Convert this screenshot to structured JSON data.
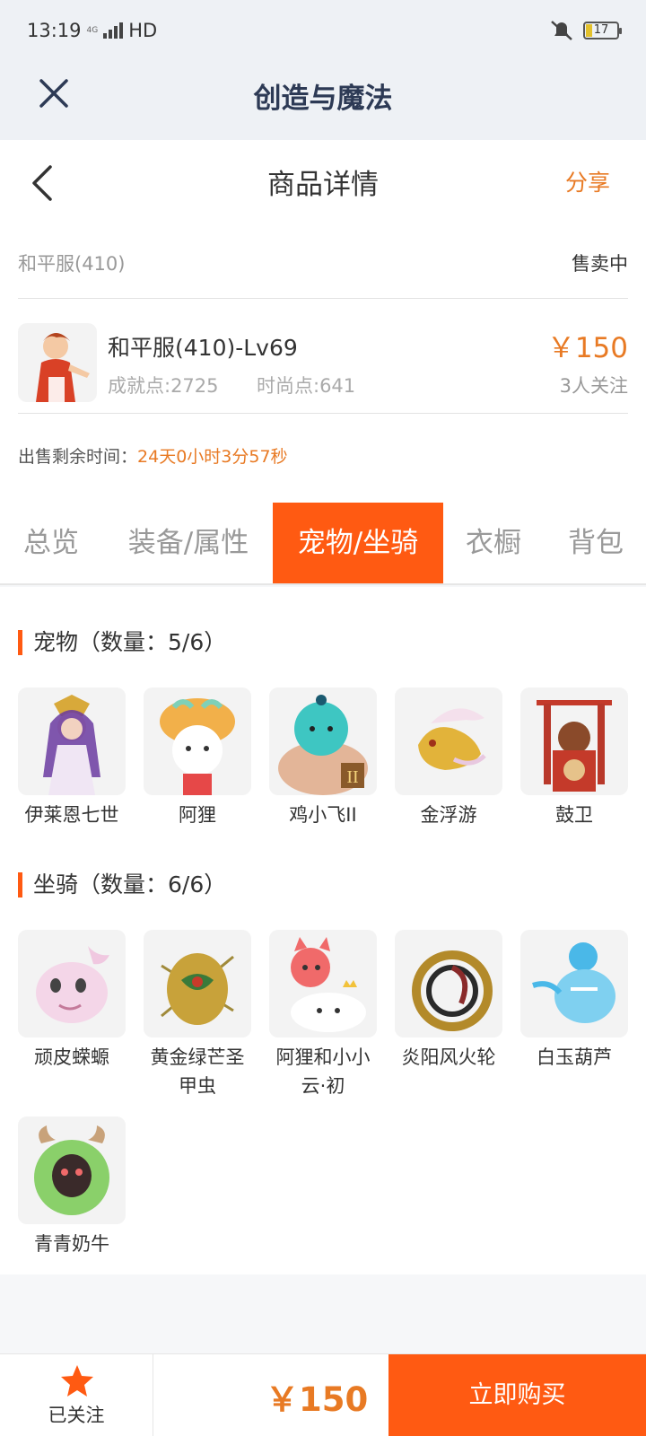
{
  "status_bar": {
    "time": "13:19",
    "network": "4G",
    "hd": "HD",
    "battery": "17"
  },
  "app": {
    "title": "创造与魔法"
  },
  "detail": {
    "title": "商品详情",
    "share": "分享",
    "server": "和平服(410)",
    "sale_status": "售卖中",
    "character": "和平服(410)-Lv69",
    "achievement": "成就点:2725",
    "fashion": "时尚点:641",
    "price": "￥150",
    "followers": "3人关注",
    "remaining_label": "出售剩余时间：",
    "remaining_time": "24天0小时3分57秒"
  },
  "tabs": [
    "总览",
    "装备/属性",
    "宠物/坐骑",
    "衣橱",
    "背包"
  ],
  "active_tab": "宠物/坐骑",
  "pets": {
    "title": "宠物（数量：5/6）",
    "items": [
      {
        "name": "伊莱恩七世",
        "color": "#a066c8"
      },
      {
        "name": "阿狸",
        "color": "#f2b04a"
      },
      {
        "name": "鸡小飞II",
        "color": "#3ec6c2"
      },
      {
        "name": "金浮游",
        "color": "#e2b33a"
      },
      {
        "name": "鼓卫",
        "color": "#c43a2a"
      }
    ]
  },
  "mounts": {
    "title": "坐骑（数量：6/6）",
    "items": [
      {
        "name": "顽皮蝾螈",
        "color": "#e8b8d8"
      },
      {
        "name": "黄金绿芒圣甲虫",
        "color": "#c8a23a"
      },
      {
        "name": "阿狸和小小云·初",
        "color": "#f06a6a"
      },
      {
        "name": "炎阳风火轮",
        "color": "#b38a2a"
      },
      {
        "name": "白玉葫芦",
        "color": "#4ab8e8"
      },
      {
        "name": "青青奶牛",
        "color": "#8ad06a"
      }
    ]
  },
  "bottom": {
    "follow_label": "已关注",
    "price": "￥150",
    "buy": "立即购买"
  }
}
